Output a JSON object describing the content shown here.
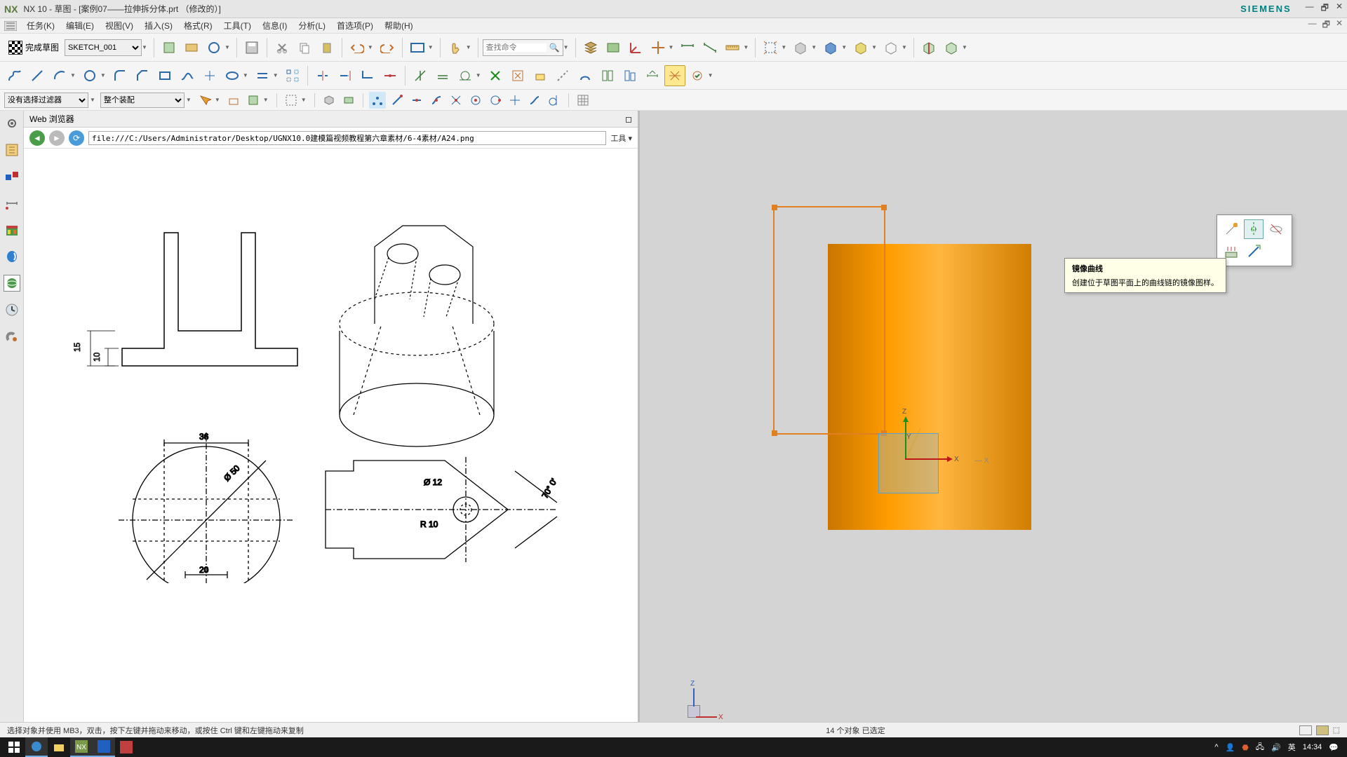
{
  "title": {
    "app": "NX 10",
    "doc": "草图 - [案例07——拉伸拆分体.prt （修改的）]",
    "brand": "SIEMENS"
  },
  "menu": {
    "items": [
      "任务(K)",
      "编辑(E)",
      "视图(V)",
      "插入(S)",
      "格式(R)",
      "工具(T)",
      "信息(I)",
      "分析(L)",
      "首选项(P)",
      "帮助(H)"
    ]
  },
  "toolbar1": {
    "finish_label": "完成草图",
    "sketch_name": "SKETCH_001",
    "search_placeholder": "查找命令"
  },
  "filter": {
    "no_filter": "没有选择过滤器",
    "scope": "整个装配"
  },
  "browser": {
    "title": "Web 浏览器",
    "url": "file:///C:/Users/Administrator/Desktop/UGNX10.0建模篇视频教程第六章素材/6-4素材/A24.png",
    "tools": "工具",
    "dims": {
      "d15": "15",
      "d10": "10",
      "d36": "36",
      "d20": "20",
      "d50": "50",
      "d50b": "50",
      "phi50": "Ø 50",
      "phi12": "Ø 12",
      "r10": "R 10",
      "ang70": "70° 0'"
    }
  },
  "viewport": {
    "axes": {
      "x": "X",
      "y": "Y",
      "z": "Z"
    }
  },
  "tooltip": {
    "title": "镜像曲线",
    "desc": "创建位于草图平面上的曲线链的镜像图样。"
  },
  "status": {
    "left": "选择对象并使用 MB3，双击，按下左键并拖动来移动，或按住 Ctrl 键和左键拖动来复制",
    "right": "14 个对象 已选定"
  },
  "taskbar": {
    "ime": "英",
    "time": "14:34"
  }
}
